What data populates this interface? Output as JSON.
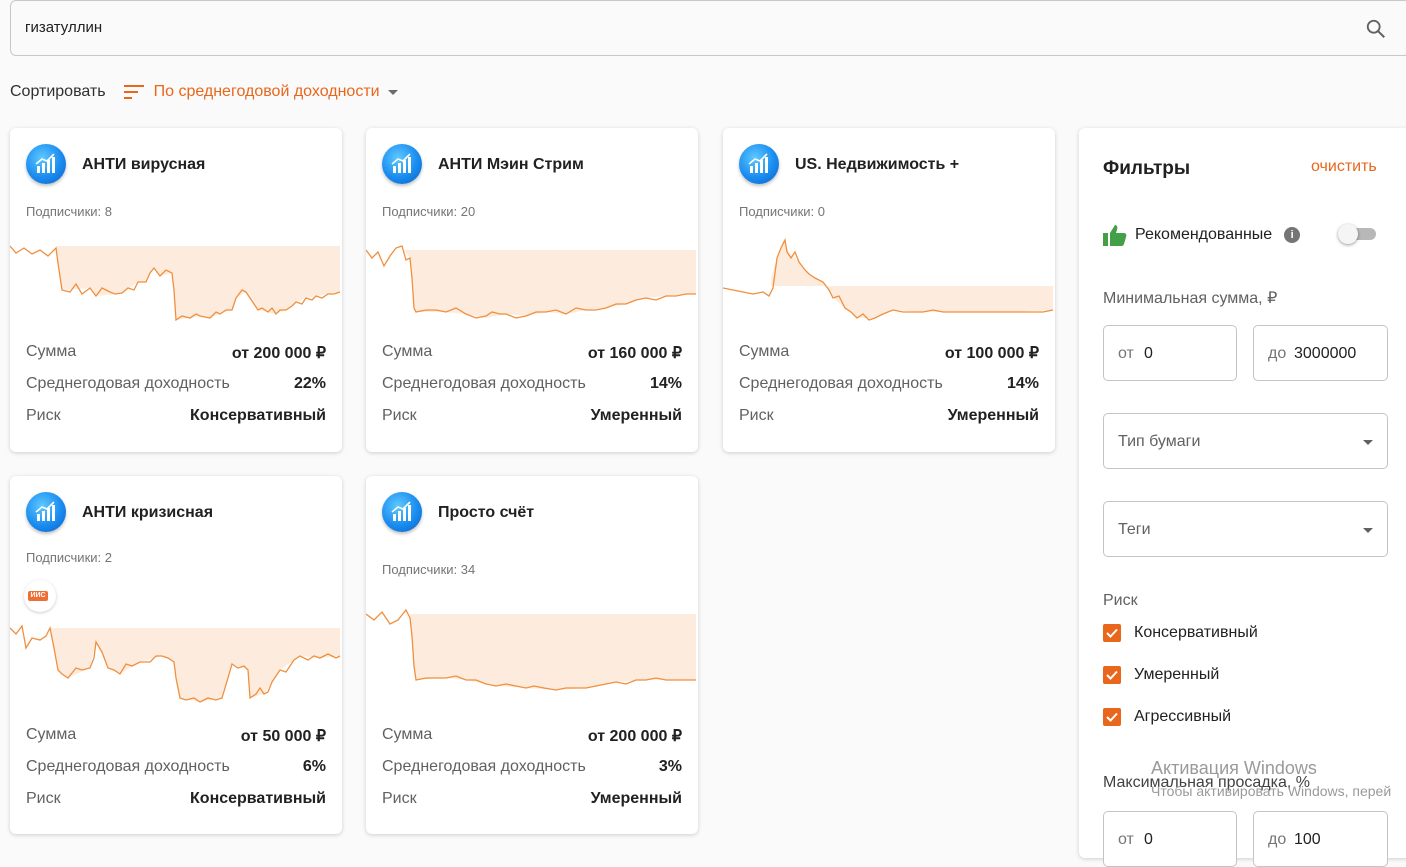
{
  "search": {
    "value": "гизатуллин",
    "icon": "search-icon"
  },
  "sort": {
    "label": "Сортировать",
    "selected": "По среднегодовой доходности"
  },
  "accent": "#e8671c",
  "cards": [
    {
      "title": "АНТИ вирусная",
      "subscribers": "Подписчики: 8",
      "sum_label": "Сумма",
      "sum": "от 200 000 ₽",
      "yield_label": "Среднегодовая доходность",
      "yield": "22%",
      "risk_label": "Риск",
      "risk": "Консервативный"
    },
    {
      "title": "АНТИ Мэин Стрим",
      "subscribers": "Подписчики: 20",
      "sum_label": "Сумма",
      "sum": "от 160 000 ₽",
      "yield_label": "Среднегодовая доходность",
      "yield": "14%",
      "risk_label": "Риск",
      "risk": "Умеренный"
    },
    {
      "title": "US. Недвижимость +",
      "subscribers": "Подписчики: 0",
      "sum_label": "Сумма",
      "sum": "от 100 000 ₽",
      "yield_label": "Среднегодовая доходность",
      "yield": "14%",
      "risk_label": "Риск",
      "risk": "Умеренный"
    },
    {
      "title": "АНТИ кризисная",
      "subscribers": "Подписчики: 2",
      "badge": "ИИС",
      "sum_label": "Сумма",
      "sum": "от 50 000 ₽",
      "yield_label": "Среднегодовая доходность",
      "yield": "6%",
      "risk_label": "Риск",
      "risk": "Консервативный"
    },
    {
      "title": "Просто счёт",
      "subscribers": "Подписчики: 34",
      "sum_label": "Сумма",
      "sum": "от 200 000 ₽",
      "yield_label": "Среднегодовая доходность",
      "yield": "3%",
      "risk_label": "Риск",
      "risk": "Умеренный"
    }
  ],
  "filters": {
    "title": "Фильтры",
    "clear": "очистить",
    "recommended": "Рекомендованные",
    "recommended_on": false,
    "min_sum_label": "Минимальная сумма, ₽",
    "from_prefix": "от",
    "to_prefix": "до",
    "min_from": "0",
    "min_to": "3000000",
    "paper_type": "Тип бумаги",
    "tags": "Теги",
    "risk_label": "Риск",
    "risk_options": [
      {
        "label": "Консервативный",
        "checked": true
      },
      {
        "label": "Умеренный",
        "checked": true
      },
      {
        "label": "Агрессивный",
        "checked": true
      }
    ],
    "drawdown_label": "Максимальная просадка, %",
    "drawdown_from": "0",
    "drawdown_to": "100"
  },
  "watermark": {
    "line1": "Активация Windows",
    "line2": "Чтобы активировать Windows, перей"
  }
}
